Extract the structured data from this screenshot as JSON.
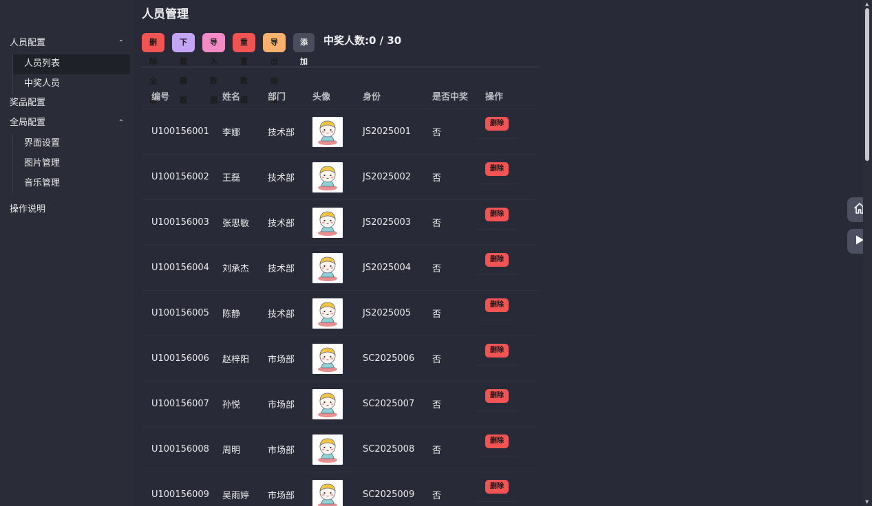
{
  "sidebar": {
    "groups": [
      {
        "label": "人员配置",
        "chevron": "⌃",
        "items": [
          "人员列表",
          "中奖人员"
        ]
      },
      {
        "label": "奖品配置"
      },
      {
        "label": "全局配置",
        "chevron": "⌃",
        "items": [
          "界面设置",
          "图片管理",
          "音乐管理"
        ]
      },
      {
        "label": "操作说明"
      }
    ]
  },
  "page": {
    "title": "人员管理"
  },
  "toolbar": {
    "delete_all": "删除全部",
    "download_template": "下载模板",
    "import_data": "导入数据",
    "reset_data": "重置数据",
    "export_result": "导出结果",
    "add": "添加",
    "count_label": "中奖人数:0 / 30"
  },
  "table": {
    "headers": [
      "编号",
      "姓名",
      "部门",
      "头像",
      "身份",
      "是否中奖",
      "操作"
    ],
    "delete_label": "删除",
    "rows": [
      {
        "id": "U100156001",
        "name": "李娜",
        "dept": "技术部",
        "identity": "JS2025001",
        "won": "否"
      },
      {
        "id": "U100156002",
        "name": "王磊",
        "dept": "技术部",
        "identity": "JS2025002",
        "won": "否"
      },
      {
        "id": "U100156003",
        "name": "张思敏",
        "dept": "技术部",
        "identity": "JS2025003",
        "won": "否"
      },
      {
        "id": "U100156004",
        "name": "刘承杰",
        "dept": "技术部",
        "identity": "JS2025004",
        "won": "否"
      },
      {
        "id": "U100156005",
        "name": "陈静",
        "dept": "技术部",
        "identity": "JS2025005",
        "won": "否"
      },
      {
        "id": "U100156006",
        "name": "赵梓阳",
        "dept": "市场部",
        "identity": "SC2025006",
        "won": "否"
      },
      {
        "id": "U100156007",
        "name": "孙悦",
        "dept": "市场部",
        "identity": "SC2025007",
        "won": "否"
      },
      {
        "id": "U100156008",
        "name": "周明",
        "dept": "市场部",
        "identity": "SC2025008",
        "won": "否"
      },
      {
        "id": "U100156009",
        "name": "吴雨婷",
        "dept": "市场部",
        "identity": "SC2025009",
        "won": "否"
      }
    ]
  },
  "floating": {
    "home_icon": "home-icon",
    "play_icon": "play-icon"
  }
}
